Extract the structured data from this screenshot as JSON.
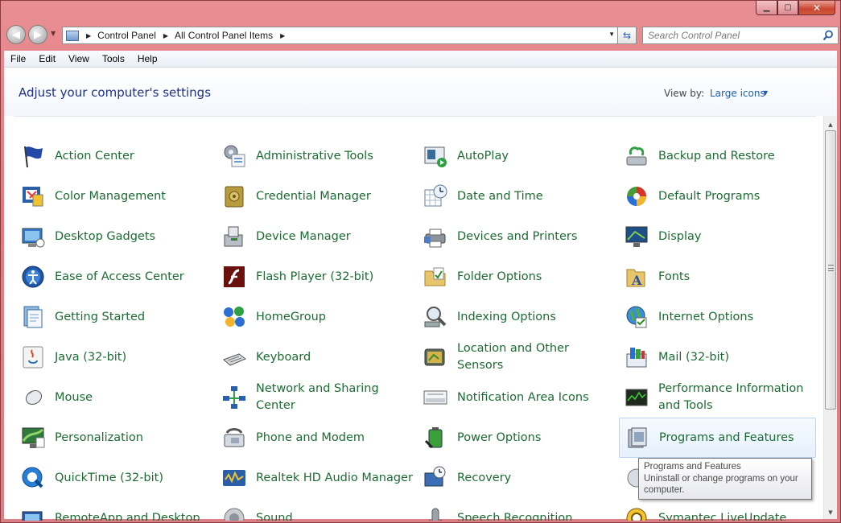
{
  "window": {
    "caption_buttons": [
      "minimize",
      "maximize",
      "close"
    ]
  },
  "nav": {
    "breadcrumb": [
      "Control Panel",
      "All Control Panel Items"
    ],
    "search_placeholder": "Search Control Panel"
  },
  "menu": [
    "File",
    "Edit",
    "View",
    "Tools",
    "Help"
  ],
  "header": {
    "title": "Adjust your computer's settings",
    "view_by_label": "View by:",
    "view_by_value": "Large icons"
  },
  "items": [
    {
      "label": "Action Center",
      "icon": "flag-icon"
    },
    {
      "label": "Administrative Tools",
      "icon": "admin-tools-icon"
    },
    {
      "label": "AutoPlay",
      "icon": "autoplay-icon"
    },
    {
      "label": "Backup and Restore",
      "icon": "backup-icon"
    },
    {
      "label": "Color Management",
      "icon": "color-management-icon"
    },
    {
      "label": "Credential Manager",
      "icon": "vault-icon"
    },
    {
      "label": "Date and Time",
      "icon": "calendar-clock-icon"
    },
    {
      "label": "Default Programs",
      "icon": "default-programs-icon"
    },
    {
      "label": "Desktop Gadgets",
      "icon": "gadgets-icon"
    },
    {
      "label": "Device Manager",
      "icon": "device-manager-icon"
    },
    {
      "label": "Devices and Printers",
      "icon": "printer-icon"
    },
    {
      "label": "Display",
      "icon": "monitor-icon"
    },
    {
      "label": "Ease of Access Center",
      "icon": "ease-of-access-icon"
    },
    {
      "label": "Flash Player (32-bit)",
      "icon": "flash-icon"
    },
    {
      "label": "Folder Options",
      "icon": "folder-options-icon"
    },
    {
      "label": "Fonts",
      "icon": "fonts-folder-icon"
    },
    {
      "label": "Getting Started",
      "icon": "getting-started-icon"
    },
    {
      "label": "HomeGroup",
      "icon": "homegroup-icon"
    },
    {
      "label": "Indexing Options",
      "icon": "indexing-icon"
    },
    {
      "label": "Internet Options",
      "icon": "internet-options-icon"
    },
    {
      "label": "Java (32-bit)",
      "icon": "java-icon"
    },
    {
      "label": "Keyboard",
      "icon": "keyboard-icon"
    },
    {
      "label": "Location and Other Sensors",
      "icon": "gps-icon"
    },
    {
      "label": "Mail (32-bit)",
      "icon": "mail-icon"
    },
    {
      "label": "Mouse",
      "icon": "mouse-icon"
    },
    {
      "label": "Network and Sharing Center",
      "icon": "network-icon"
    },
    {
      "label": "Notification Area Icons",
      "icon": "notification-icon"
    },
    {
      "label": "Performance Information and Tools",
      "icon": "performance-icon"
    },
    {
      "label": "Personalization",
      "icon": "personalization-icon"
    },
    {
      "label": "Phone and Modem",
      "icon": "phone-icon"
    },
    {
      "label": "Power Options",
      "icon": "battery-icon"
    },
    {
      "label": "Programs and Features",
      "icon": "programs-icon"
    },
    {
      "label": "QuickTime (32-bit)",
      "icon": "quicktime-icon"
    },
    {
      "label": "Realtek HD Audio Manager",
      "icon": "audio-manager-icon"
    },
    {
      "label": "Recovery",
      "icon": "recovery-icon"
    },
    {
      "label": "",
      "icon": "hidden-icon"
    },
    {
      "label": "RemoteApp and Desktop",
      "icon": "remoteapp-icon"
    },
    {
      "label": "Sound",
      "icon": "speaker-icon"
    },
    {
      "label": "Speech Recognition",
      "icon": "microphone-icon"
    },
    {
      "label": "Symantec LiveUpdate",
      "icon": "liveupdate-icon"
    }
  ],
  "tooltip": {
    "title": "Programs and Features",
    "description": "Uninstall or change programs on your computer."
  },
  "colors": {
    "link_green": "#1d6b33",
    "title_blue": "#1e3287",
    "frame": "#e47a80"
  }
}
